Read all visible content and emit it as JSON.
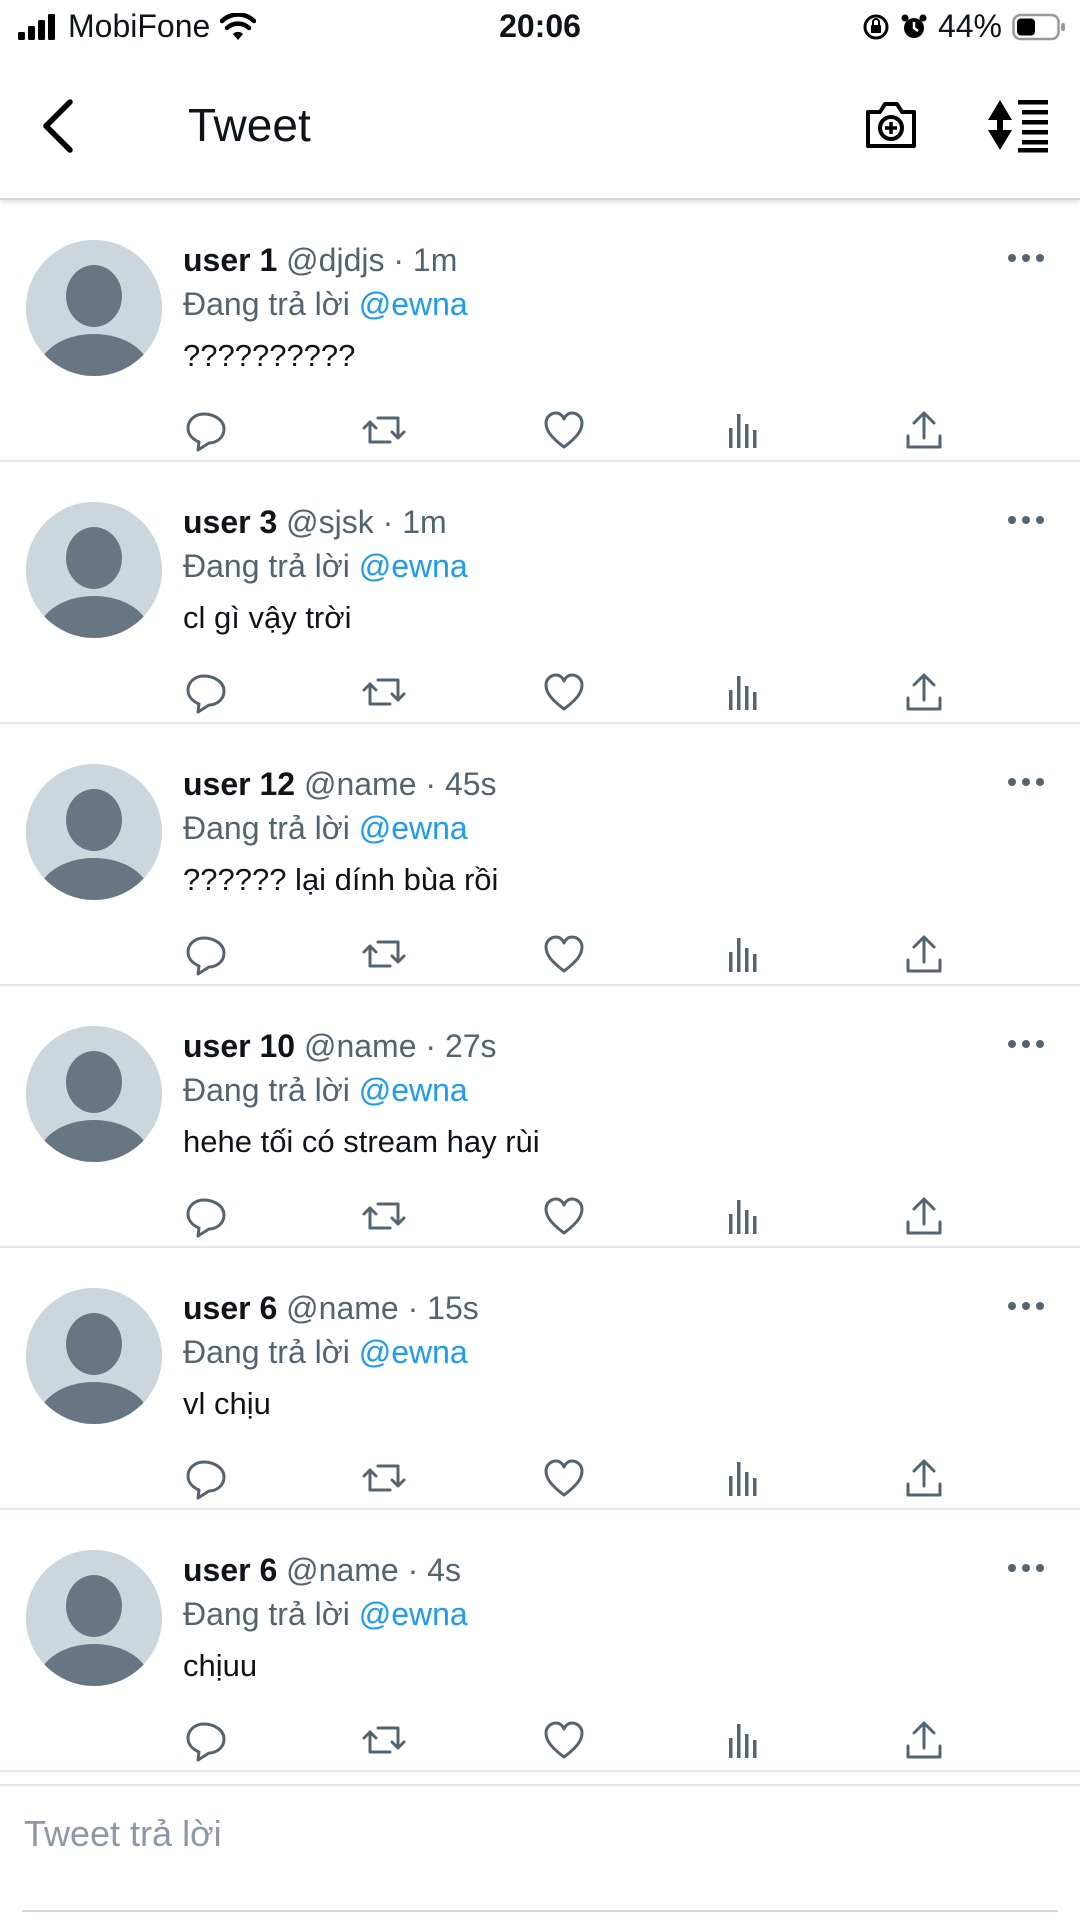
{
  "status_bar": {
    "carrier": "MobiFone",
    "time": "20:06",
    "battery": "44%"
  },
  "header": {
    "title": "Tweet"
  },
  "tweets": [
    {
      "name": "user 1",
      "meta": " @djdjs · 1m",
      "reply_prefix": "Đang trả lời ",
      "reply_to": "@ewna",
      "text": "??????????"
    },
    {
      "name": "user 3",
      "meta": " @sjsk · 1m",
      "reply_prefix": "Đang trả lời ",
      "reply_to": "@ewna",
      "text": "cl gì vậy trời"
    },
    {
      "name": "user 12",
      "meta": " @name · 45s",
      "reply_prefix": "Đang trả lời ",
      "reply_to": "@ewna",
      "text": "?????? lại dính bùa rồi"
    },
    {
      "name": "user 10",
      "meta": " @name · 27s",
      "reply_prefix": "Đang trả lời ",
      "reply_to": "@ewna",
      "text": "hehe tối có stream hay rùi"
    },
    {
      "name": "user 6",
      "meta": " @name · 15s",
      "reply_prefix": "Đang trả lời ",
      "reply_to": "@ewna",
      "text": "vl chịu"
    },
    {
      "name": "user 6",
      "meta": " @name · 4s",
      "reply_prefix": "Đang trả lời ",
      "reply_to": "@ewna",
      "text": "chịuu"
    }
  ],
  "compose": {
    "placeholder": "Tweet trả lời"
  },
  "colors": {
    "accent": "#1d9bf0",
    "secondary_text": "#536471",
    "avatar_bg": "#ccd6dd",
    "avatar_fg": "#687684"
  }
}
